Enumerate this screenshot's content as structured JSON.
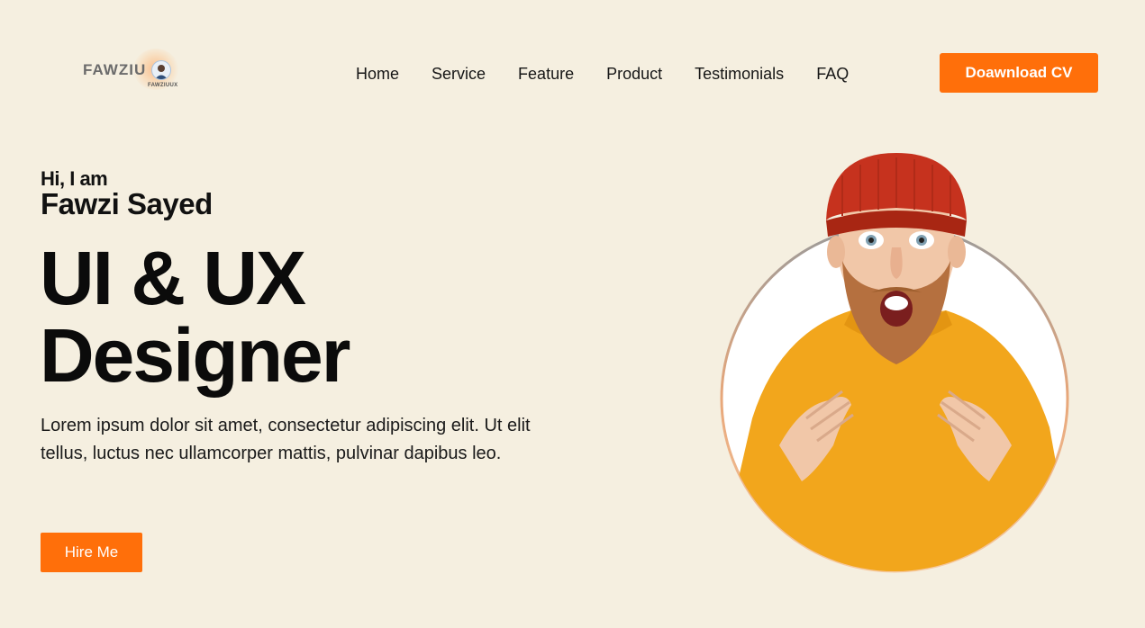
{
  "header": {
    "logo": {
      "text": "FAWZIU",
      "small_text": "FAWZIUUX"
    },
    "nav": [
      {
        "label": "Home"
      },
      {
        "label": "Service"
      },
      {
        "label": "Feature"
      },
      {
        "label": "Product"
      },
      {
        "label": "Testimonials"
      },
      {
        "label": "FAQ"
      }
    ],
    "cv_button": "Doawnload CV"
  },
  "hero": {
    "greeting": "Hi, I am",
    "name": "Fawzi Sayed",
    "headline_line1": "UI & UX",
    "headline_line2": "Designer",
    "description": "Lorem ipsum dolor sit amet, consectetur adipiscing elit. Ut elit tellus, luctus nec ullamcorper mattis, pulvinar dapibus leo.",
    "hire_button": "Hire Me",
    "portrait_alt": "man-in-red-beanie-yellow-sweater"
  },
  "colors": {
    "background": "#f5efe0",
    "accent": "#ff6f0a",
    "text": "#111111"
  }
}
